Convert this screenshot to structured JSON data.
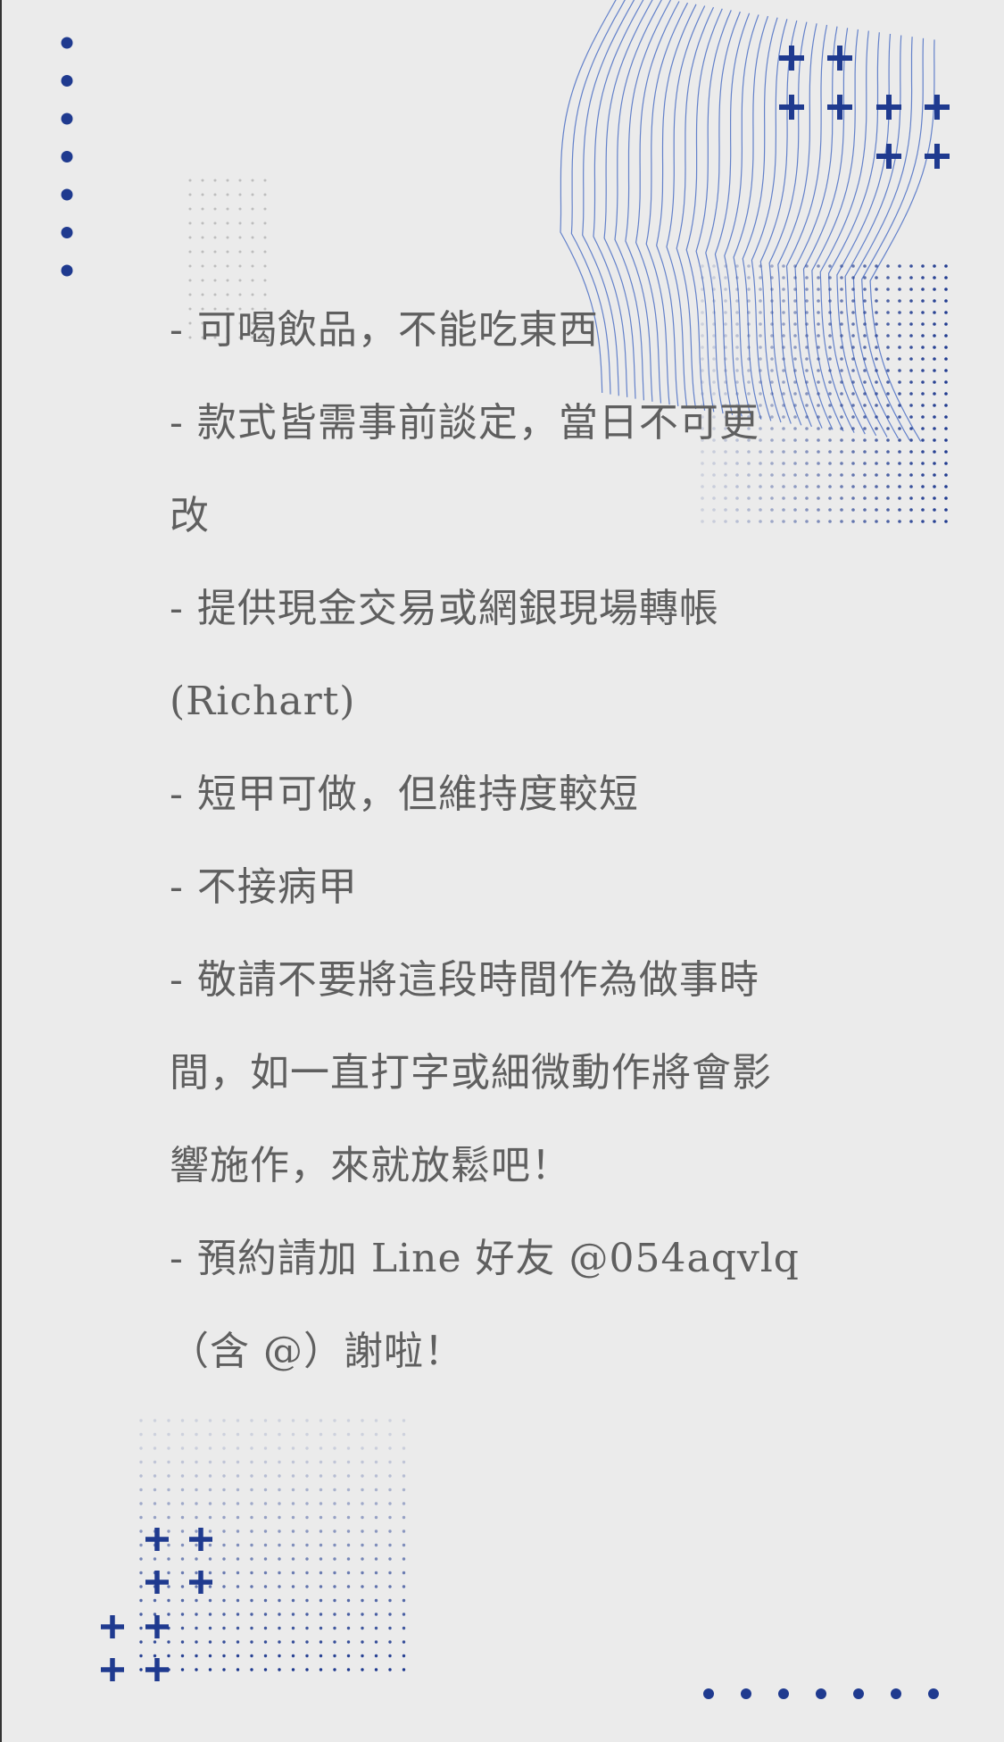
{
  "colors": {
    "background": "#ebebeb",
    "accent": "#1f3a8f",
    "accent_light": "#4b6ec4",
    "text": "#5f5f5f",
    "dot_gray": "#bdbdbd"
  },
  "decorations": {
    "icon_names": [
      "plus-icon",
      "dot-icon",
      "wave-lines",
      "dot-grid"
    ]
  },
  "notice": {
    "items": [
      "- 可喝飲品，不能吃東西",
      "- 款式皆需事前談定，當日不可更\n改",
      "- 提供現金交易或網銀現場轉帳\n(Richart)",
      "- 短甲可做，但維持度較短",
      "- 不接病甲",
      "- 敬請不要將這段時間作為做事時\n間，如一直打字或細微動作將會影\n響施作，來就放鬆吧！",
      "- 預約請加 Line 好友 @054aqvlq\n（含 @）謝啦！"
    ]
  }
}
